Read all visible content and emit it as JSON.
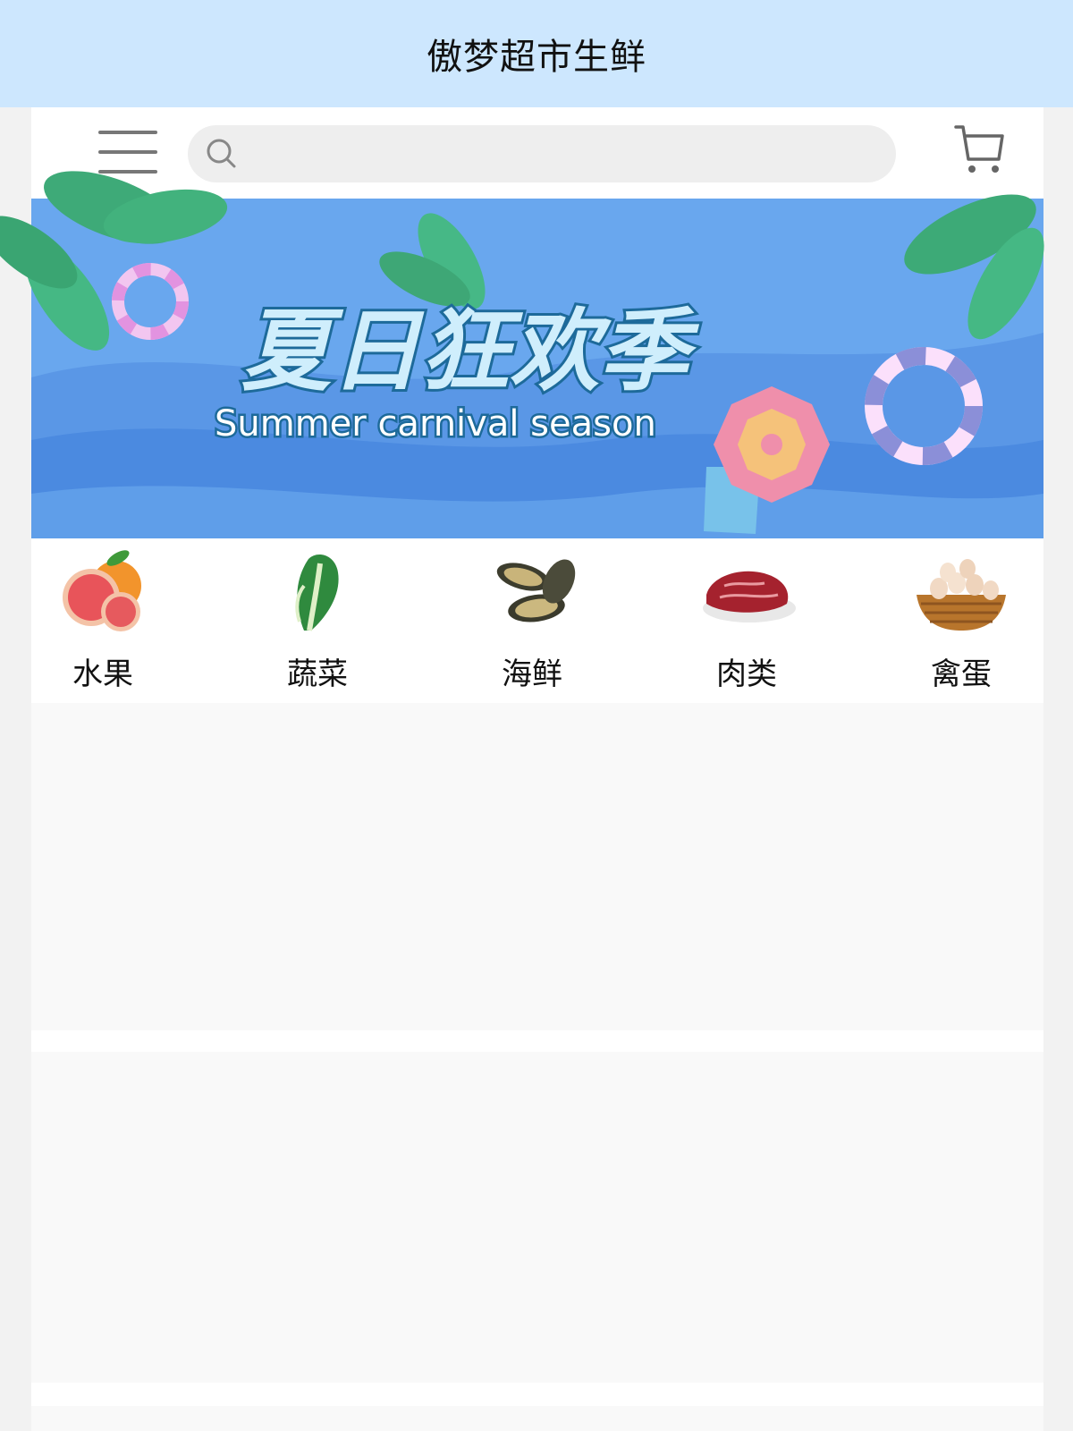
{
  "header": {
    "title": "傲梦超市生鲜"
  },
  "search": {
    "placeholder": "",
    "value": ""
  },
  "icons": {
    "menu": "hamburger-menu-icon",
    "search": "search-icon",
    "cart": "shopping-cart-icon"
  },
  "banner": {
    "title_cn": "夏日狂欢季",
    "subtitle_en": "Summer carnival season",
    "background_color": "#69a7ee"
  },
  "categories": [
    {
      "label": "水果",
      "icon": "fruit-icon"
    },
    {
      "label": "蔬菜",
      "icon": "vegetable-icon"
    },
    {
      "label": "海鲜",
      "icon": "seafood-icon"
    },
    {
      "label": "肉类",
      "icon": "meat-icon"
    },
    {
      "label": "禽蛋",
      "icon": "eggs-icon"
    }
  ],
  "colors": {
    "header_bg": "#cde7fe",
    "page_bg": "#f2f2f2",
    "content_bg": "#ffffff",
    "placeholder_bg": "#f9f9f9",
    "search_bg": "#eeeeee"
  }
}
